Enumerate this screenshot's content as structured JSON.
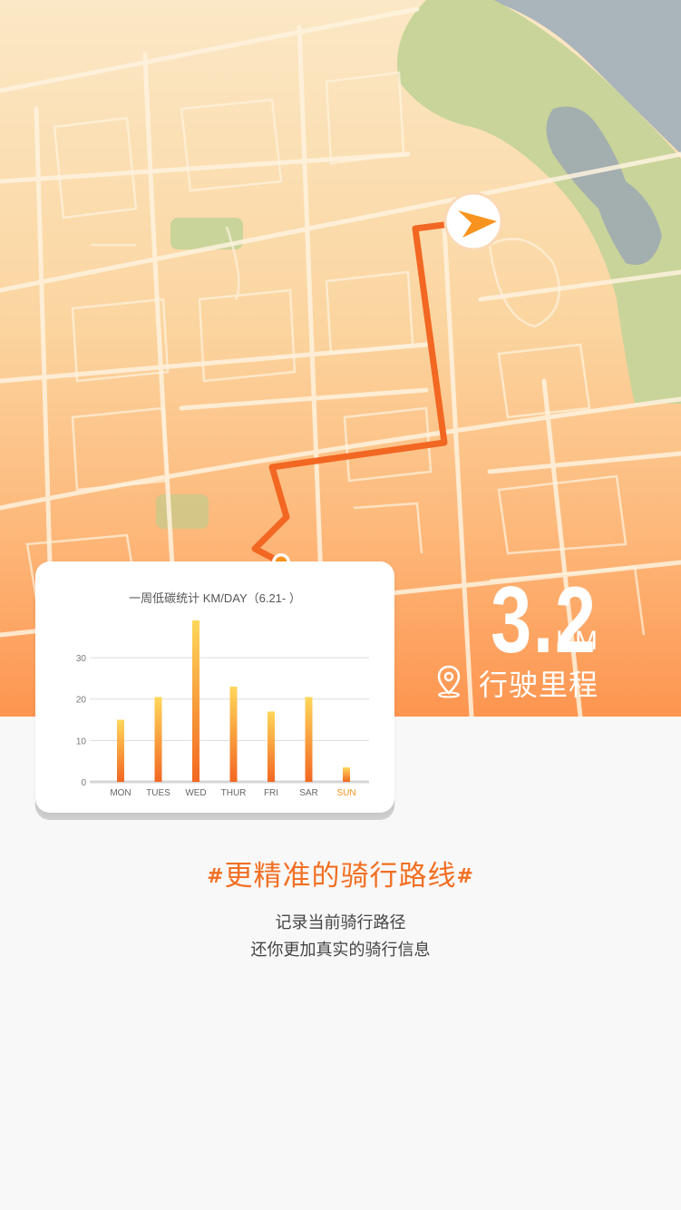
{
  "distance": {
    "value": "3.2",
    "unit": "KM",
    "label": "行驶里程"
  },
  "card": {
    "title": "一周低碳统计 KM/DAY（6.21- ）"
  },
  "chart_data": {
    "type": "bar",
    "title": "一周低碳统计 KM/DAY（6.21- ）",
    "categories": [
      "MON",
      "TUES",
      "WED",
      "THUR",
      "FRI",
      "SAR",
      "SUN"
    ],
    "values": [
      15,
      20.5,
      39,
      23,
      17,
      20.5,
      3.5
    ],
    "yticks": [
      "0",
      "10",
      "20",
      "30"
    ],
    "ylim": [
      0,
      39
    ],
    "grid": true,
    "highlight_category": "SUN",
    "colors": {
      "bar_top": "#ffd75a",
      "bar_bottom": "#f26722",
      "highlight_label": "#f7931e"
    }
  },
  "headline": {
    "hash_left": "#",
    "text": "更精准的骑行路线",
    "hash_right": "#"
  },
  "description": {
    "line1": "记录当前骑行路径",
    "line2": "还你更加真实的骑行信息"
  },
  "colors": {
    "accent": "#f26f22",
    "route": "#f26722",
    "map_top": "#fbe8c6",
    "map_bottom": "#fd9c55",
    "park": "#c9d49a",
    "water": "#9faab0"
  },
  "icons": {
    "navigation": "navigation-arrow-icon",
    "location": "location-pin-icon",
    "route_end": "route-end-marker-icon"
  }
}
